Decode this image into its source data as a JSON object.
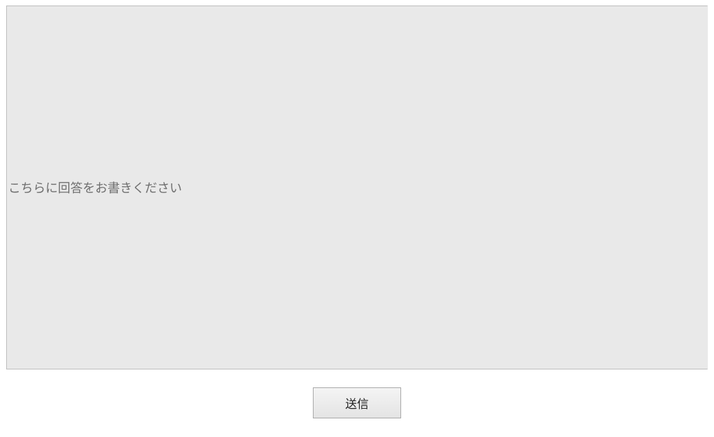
{
  "form": {
    "answer_placeholder": "こちらに回答をお書きください",
    "answer_value": "",
    "submit_label": "送信"
  }
}
